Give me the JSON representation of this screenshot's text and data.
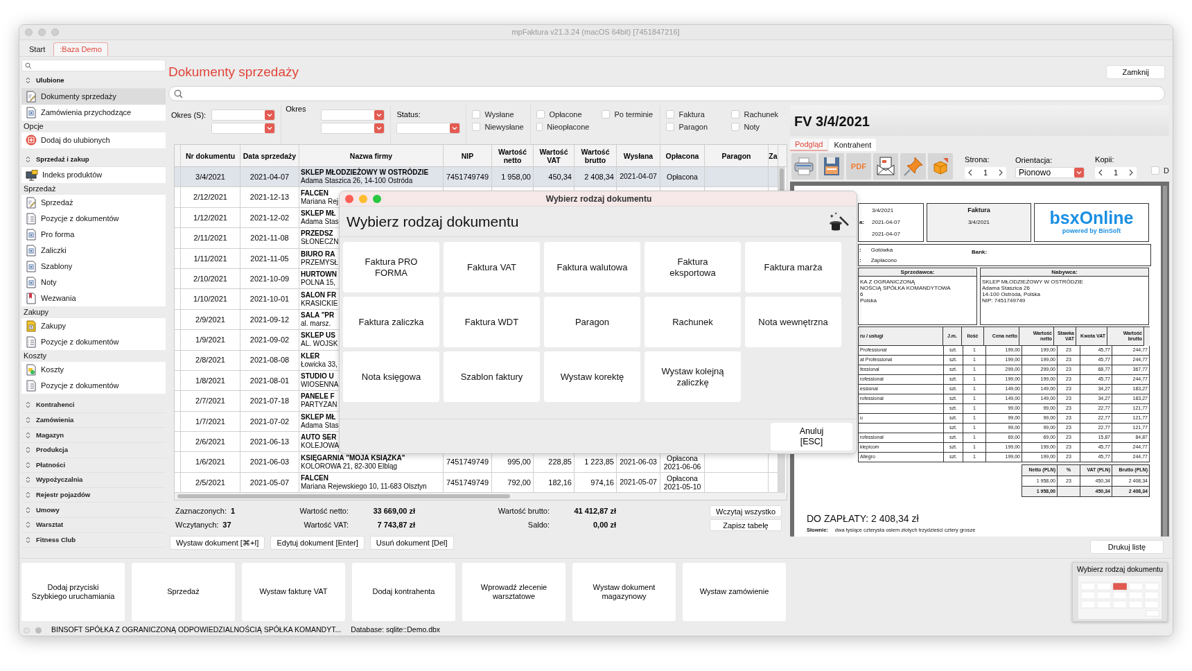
{
  "window": {
    "title": "mpFaktura v21.3.24 (macOS 64bit) [7451847216]"
  },
  "tabs": [
    {
      "label": "Start",
      "selected": false
    },
    {
      "label": ":Baza Demo",
      "selected": true
    }
  ],
  "sidebar": {
    "sections": [
      {
        "title": "Ulubione",
        "expanded": true,
        "groups": [
          {
            "items": [
              {
                "label": "Dokumenty sprzedaży",
                "kind": "edit",
                "selected": true
              },
              {
                "label": "Zamówienia przychodzące",
                "kind": "document",
                "selected": false
              }
            ]
          },
          {
            "label": "Opcje",
            "items": [
              {
                "label": "Dodaj do ulubionych",
                "kind": "add",
                "selected": false
              }
            ]
          }
        ]
      },
      {
        "title": "Sprzedaż i zakup",
        "expanded": true,
        "groups": [
          {
            "items": [
              {
                "label": "Indeks produktów",
                "kind": "product",
                "selected": false
              }
            ]
          },
          {
            "label": "Sprzedaż",
            "items": [
              {
                "label": "Sprzedaż",
                "kind": "edit",
                "selected": false
              },
              {
                "label": "Pozycje z dokumentów",
                "kind": "list",
                "selected": false
              },
              {
                "label": "Pro forma",
                "kind": "document",
                "selected": false
              },
              {
                "label": "Zaliczki",
                "kind": "document",
                "selected": false
              },
              {
                "label": "Szablony",
                "kind": "document",
                "selected": false
              },
              {
                "label": "Noty",
                "kind": "document",
                "selected": false
              },
              {
                "label": "Wezwania",
                "kind": "bookmark",
                "selected": false
              }
            ]
          },
          {
            "label": "Zakupy",
            "items": [
              {
                "label": "Zakupy",
                "kind": "purchase",
                "selected": false
              },
              {
                "label": "Pozycje z dokumentów",
                "kind": "list",
                "selected": false
              }
            ]
          },
          {
            "label": "Koszty",
            "items": [
              {
                "label": "Koszty",
                "kind": "cost",
                "selected": false
              },
              {
                "label": "Pozycje z dokumentów",
                "kind": "list",
                "selected": false
              }
            ]
          }
        ]
      },
      {
        "title": "Kontrahenci",
        "expanded": false
      },
      {
        "title": "Zamówienia",
        "expanded": false
      },
      {
        "title": "Magazyn",
        "expanded": false
      },
      {
        "title": "Produkcja",
        "expanded": false
      },
      {
        "title": "Płatności",
        "expanded": false
      },
      {
        "title": "Wypożyczalnia",
        "expanded": false
      },
      {
        "title": "Rejestr pojazdów",
        "expanded": false
      },
      {
        "title": "Umowy",
        "expanded": false
      },
      {
        "title": "Warsztat",
        "expanded": false
      },
      {
        "title": "Fitness Club",
        "expanded": false
      }
    ]
  },
  "header": {
    "title": "Dokumenty sprzedaży",
    "close_button": "Zamknij"
  },
  "filters": {
    "period_s": "Okres (S):",
    "period_w": "Okres",
    "status": "Status:",
    "groups": [
      [
        [
          {
            "label": "Wysłane",
            "checked": false
          }
        ],
        [
          {
            "label": "Niewysłane",
            "checked": false
          }
        ]
      ],
      [
        [
          {
            "label": "Opłacone",
            "checked": false
          },
          {
            "label": "Po terminie",
            "checked": false
          }
        ],
        [
          {
            "label": "Nieopłacone",
            "checked": false
          }
        ]
      ],
      [
        [
          {
            "label": "Faktura",
            "checked": false
          },
          {
            "label": "Rachunek",
            "checked": false
          }
        ],
        [
          {
            "label": "Paragon",
            "checked": false
          },
          {
            "label": "Noty",
            "checked": false
          }
        ]
      ]
    ]
  },
  "table": {
    "columns": [
      "Nr dokumentu",
      "Data sprzedaży",
      "Nazwa firmy",
      "NIP",
      "Wartość netto",
      "Wartość VAT",
      "Wartość brutto",
      "Wysłana",
      "Opłacona",
      "Paragon",
      "Za"
    ],
    "rows": [
      {
        "selected": true,
        "number": "3/4/2021",
        "date": "2021-04-07",
        "company": "SKLEP MŁODZIEŻOWY W OSTRÓDZIE",
        "address": "Adama Staszica 26, 14-100 Ostróda",
        "nip": "7451749749",
        "net": "1 958,00",
        "vat": "450,34",
        "gross": "2 408,34",
        "sent": "2021-04-07",
        "paid": "Opłacona"
      },
      {
        "selected": false,
        "number": "2/12/2021",
        "date": "2021-12-13",
        "company": "FALCEN",
        "address": "Mariana Rej"
      },
      {
        "selected": false,
        "number": "1/12/2021",
        "date": "2021-12-02",
        "company": "SKLEP MŁ",
        "address": "Adama Stas"
      },
      {
        "selected": false,
        "number": "2/11/2021",
        "date": "2021-11-08",
        "company": "PRZEDSZ",
        "address": "SŁONECZN"
      },
      {
        "selected": false,
        "number": "1/11/2021",
        "date": "2021-11-05",
        "company": "BIURO RA",
        "address": "PRZEMYSŁ"
      },
      {
        "selected": false,
        "number": "2/10/2021",
        "date": "2021-10-09",
        "company": "HURTOWN",
        "address": "POLNA 15,"
      },
      {
        "selected": false,
        "number": "1/10/2021",
        "date": "2021-10-01",
        "company": "SALON FR",
        "address": "KRASICKIE"
      },
      {
        "selected": false,
        "number": "2/9/2021",
        "date": "2021-09-12",
        "company": "SALA \"PR",
        "address": "al. marsz."
      },
      {
        "selected": false,
        "number": "1/9/2021",
        "date": "2021-09-02",
        "company": "SKLEP US",
        "address": "AL. WOJSK"
      },
      {
        "selected": false,
        "number": "2/8/2021",
        "date": "2021-08-08",
        "company": "KLER",
        "address": "Łowicka 33,"
      },
      {
        "selected": false,
        "number": "1/8/2021",
        "date": "2021-08-01",
        "company": "STUDIO U",
        "address": "WIOSENNA"
      },
      {
        "selected": false,
        "number": "2/7/2021",
        "date": "2021-07-18",
        "company": "PANELE F",
        "address": "PARTYZAN"
      },
      {
        "selected": false,
        "number": "1/7/2021",
        "date": "2021-07-02",
        "company": "SKLEP MŁ",
        "address": "Adama Stas"
      },
      {
        "selected": false,
        "number": "2/6/2021",
        "date": "2021-06-13",
        "company": "AUTO SER",
        "address": "KOLEJOWA"
      },
      {
        "selected": false,
        "number": "1/6/2021",
        "date": "2021-06-03",
        "company": "KSIĘGARNIA \"MOJA KSIĄŻKA\"",
        "address": "KOLOROWA 21, 82-300 Elbląg",
        "nip": "7451749749",
        "net": "995,00",
        "vat": "228,85",
        "gross": "1 223,85",
        "sent": "2021-06-03",
        "paid": "Opłacona",
        "paid_date": "2021-06-06"
      },
      {
        "selected": false,
        "number": "2/5/2021",
        "date": "2021-05-07",
        "company": "FALCEN",
        "address": "Mariana Rejewskiego 10, 11-683 Olsztyn",
        "nip": "7451749749",
        "net": "792,00",
        "vat": "182,16",
        "gross": "974,16",
        "sent": "2021-05-07",
        "paid": "Opłacona",
        "paid_date": "2021-05-10"
      }
    ]
  },
  "summary": {
    "rows": [
      [
        {
          "label": "Zaznaczonych:",
          "value": "1"
        },
        {
          "label": "Wartość netto:",
          "value": "33 669,00 zł"
        },
        {
          "label": "Wartość brutto:",
          "value": "41 412,87 zł"
        }
      ],
      [
        {
          "label": "Wczytanych:",
          "value": "37"
        },
        {
          "label": "Wartość VAT:",
          "value": "7 743,87 zł"
        },
        {
          "label": "Saldo:",
          "value": "0,00 zł"
        }
      ]
    ],
    "buttons": [
      "Wczytaj wszystko",
      "Zapisz tabelę"
    ]
  },
  "actions": [
    "Wystaw dokument [⌘+I]",
    "Edytuj dokument [Enter]",
    "Usuń dokument [Del]"
  ],
  "preview": {
    "title": "FV 3/4/2021",
    "tabs": [
      {
        "label": "Podgląd",
        "selected": true
      },
      {
        "label": "Kontrahent",
        "selected": false
      }
    ],
    "toolbar": [
      {
        "kind": "print"
      },
      {
        "kind": "save"
      },
      {
        "kind": "pdf",
        "label": "PDF"
      },
      {
        "kind": "mail"
      },
      {
        "kind": "pin"
      },
      {
        "kind": "box"
      }
    ],
    "page": {
      "label": "Strona:",
      "value": "1"
    },
    "orientation": {
      "label": "Orientacja:",
      "value": "Pionowo"
    },
    "copies": {
      "label": "Kopii:",
      "value": "1"
    },
    "extra": {
      "label": "D",
      "checked": false
    },
    "invoice": {
      "dates": [
        {
          "value": "3/4/2021"
        },
        {
          "label": "a:",
          "value": "2021-04-07"
        },
        {
          "value": "2021-04-07"
        }
      ],
      "doc_type": "Faktura",
      "doc_number": "3/4/2021",
      "logo": "bsxOnline",
      "logo_sub": "powered by BinSoft",
      "payment": [
        {
          "label": ":",
          "value": "Gotówka"
        },
        {
          "label": ":",
          "value": "Zapłacono"
        }
      ],
      "bank": "Bank:",
      "seller": {
        "heading": "Sprzedawca:",
        "lines": [
          "KA Z OGRANICZONĄ",
          "NOŚCIĄ SPÓŁKA KOMANDYTOWA",
          "6",
          "Polska"
        ]
      },
      "buyer": {
        "heading": "Nabywca:",
        "lines": [
          "SKLEP MŁODZIEŻOWY W OSTRÓDZIE",
          "Adama Staszica 26",
          "14-100 Ostróda, Polska",
          "NIP: 7451749749"
        ]
      },
      "item_columns": [
        "ru / usługi",
        "J.m.",
        "Ilość",
        "Cena netto",
        "Wartość netto",
        "Stawka VAT",
        "Kwota VAT",
        "Wartość brutto"
      ],
      "items": [
        {
          "name": "Professional",
          "cells": [
            "szt.",
            "1",
            "199,00",
            "199,00",
            "23",
            "45,77",
            "244,77"
          ]
        },
        {
          "name": "at Professional",
          "cells": [
            "szt.",
            "1",
            "199,00",
            "199,00",
            "23",
            "45,77",
            "244,77"
          ]
        },
        {
          "name": "fessional",
          "cells": [
            "szt.",
            "1",
            "299,00",
            "299,00",
            "23",
            "68,77",
            "367,77"
          ]
        },
        {
          "name": "rofessional",
          "cells": [
            "szt.",
            "1",
            "199,00",
            "199,00",
            "23",
            "45,77",
            "244,77"
          ]
        },
        {
          "name": "essional",
          "cells": [
            "szt.",
            "1",
            "149,00",
            "149,00",
            "23",
            "34,27",
            "183,27"
          ]
        },
        {
          "name": "rofessional",
          "cells": [
            "szt.",
            "1",
            "149,00",
            "149,00",
            "23",
            "34,27",
            "183,27"
          ]
        },
        {
          "cells": [
            "szt.",
            "1",
            "99,00",
            "99,00",
            "23",
            "22,77",
            "121,77"
          ]
        },
        {
          "name": "u",
          "cells": [
            "szt.",
            "1",
            "99,00",
            "99,00",
            "23",
            "22,77",
            "121,77"
          ]
        },
        {
          "cells": [
            "szt.",
            "1",
            "99,00",
            "99,00",
            "23",
            "22,77",
            "121,77"
          ]
        },
        {
          "name": "rofessional",
          "cells": [
            "szt.",
            "1",
            "69,00",
            "69,00",
            "23",
            "15,87",
            "84,87"
          ]
        },
        {
          "name": "klepicom",
          "cells": [
            "szt.",
            "1",
            "199,00",
            "199,00",
            "23",
            "45,77",
            "244,77"
          ]
        },
        {
          "name": "Allegro",
          "cells": [
            "szt.",
            "1",
            "199,00",
            "199,00",
            "23",
            "45,77",
            "244,77"
          ]
        }
      ],
      "total_columns": [
        "Netto (PLN)",
        "%",
        "VAT (PLN)",
        "Brutto (PLN)"
      ],
      "totals": [
        {
          "kind": "rate",
          "cells": [
            "1 958,00",
            "23",
            "450,34",
            "2 408,34"
          ]
        },
        {
          "kind": "sum",
          "cells": [
            "1 958,00",
            "",
            "450,34",
            "2 408,34"
          ]
        }
      ],
      "to_pay": "DO ZAPŁATY: 2 408,34 zł",
      "words_label": "Słownie:",
      "words": "dwa tysiące czterysta osiem złotych trzydzieści cztery grosze"
    },
    "print_button": "Drukuj listę"
  },
  "dialog": {
    "title": "Wybierz rodzaj dokumentu",
    "heading": "Wybierz rodzaj dokumentu",
    "options": [
      "Faktura PRO FORMA",
      "Faktura VAT",
      "Faktura walutowa",
      "Faktura eksportowa",
      "Faktura marża",
      "Faktura zaliczka",
      "Faktura WDT",
      "Paragon",
      "Rachunek",
      "Nota wewnętrzna",
      "Nota księgowa",
      "Szablon faktury",
      "Wystaw korektę",
      "Wystaw kolejną zaliczkę"
    ],
    "cancel": [
      "Anuluj",
      "[ESC]"
    ]
  },
  "quick_launch": {
    "buttons": [
      "Dodaj przyciski Szybkiego uruchamiania",
      "Sprzedaż",
      "Wystaw fakturę VAT",
      "Dodaj kontrahenta",
      "Wprowadź zlecenie warsztatowe",
      "Wystaw dokument magazynowy",
      "Wystaw zamówienie"
    ],
    "thumbnail": "Wybierz rodzaj dokumentu"
  },
  "status_bar": {
    "company": "BINSOFT SPÓŁKA Z OGRANICZONĄ ODPOWIEDZIALNOŚCIĄ SPÓŁKA KOMANDYT...",
    "database": "Database: sqlite::Demo.dbx"
  }
}
